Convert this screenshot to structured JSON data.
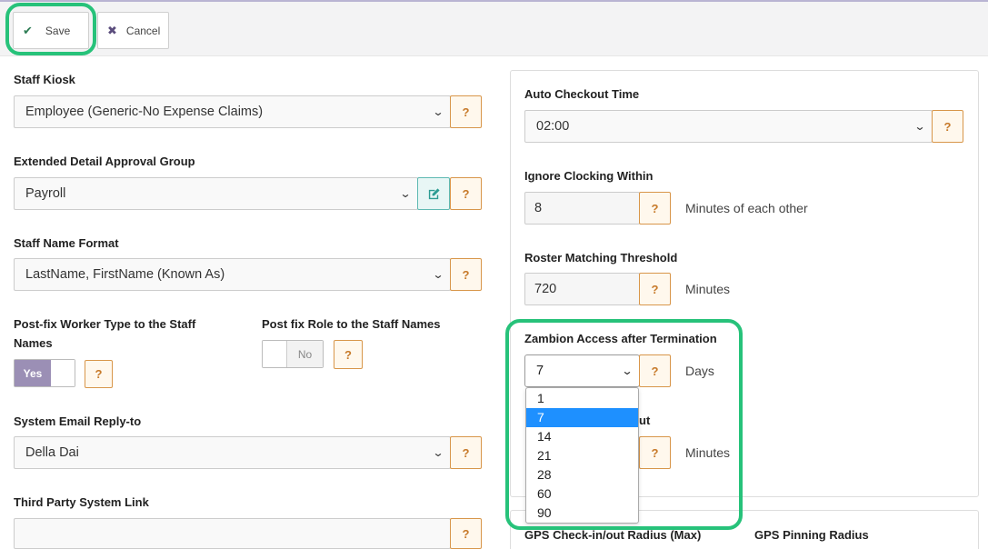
{
  "toolbar": {
    "save_label": "Save",
    "cancel_label": "Cancel"
  },
  "help_label": "?",
  "left": {
    "staff_kiosk": {
      "label": "Staff Kiosk",
      "value": "Employee (Generic-No Expense Claims)"
    },
    "approval_group": {
      "label": "Extended Detail Approval Group",
      "value": "Payroll"
    },
    "name_format": {
      "label": "Staff Name Format",
      "value": "LastName, FirstName (Known As)"
    },
    "postfix_worker": {
      "label_line1": "Post-fix Worker Type to the Staff",
      "label_line2": "Names",
      "value": "Yes"
    },
    "postfix_role": {
      "label": "Post fix Role to the Staff Names",
      "value": "No"
    },
    "email_reply": {
      "label": "System Email Reply-to",
      "value": "Della Dai"
    },
    "third_party": {
      "label": "Third Party System Link",
      "value": ""
    }
  },
  "right": {
    "auto_checkout": {
      "label": "Auto Checkout Time",
      "value": "02:00"
    },
    "ignore_clocking": {
      "label": "Ignore Clocking Within",
      "value": "8",
      "unit": "Minutes of each other"
    },
    "roster_threshold": {
      "label": "Roster Matching Threshold",
      "value": "720",
      "unit": "Minutes"
    },
    "zambion_access": {
      "label": "Zambion Access after Termination",
      "value": "7",
      "unit": "Days",
      "options": [
        "1",
        "7",
        "14",
        "21",
        "28",
        "60",
        "90"
      ],
      "selected_index": 1
    },
    "hidden_field": {
      "label_fragment": "ut",
      "unit": "Minutes"
    },
    "gps_checkin": {
      "label": "GPS Check-in/out Radius (Max)"
    },
    "gps_pinning": {
      "label": "GPS Pinning Radius"
    }
  }
}
